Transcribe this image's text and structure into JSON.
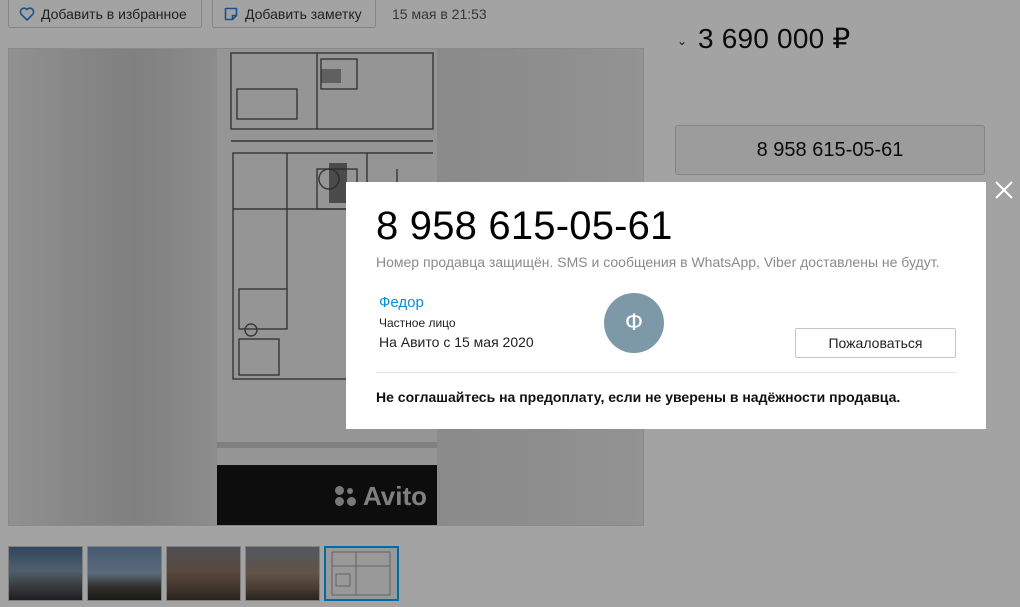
{
  "toolbar": {
    "favorite_label": "Добавить в избранное",
    "note_label": "Добавить заметку",
    "date": "15 мая в 21:53"
  },
  "listing": {
    "price": "3 690 000 ₽",
    "phone_button": "8 958 615-05-61"
  },
  "gallery": {
    "watermark": "Avito",
    "thumbnails": [
      "фото 1",
      "фото 2",
      "фото 3",
      "фото 4",
      "планировка"
    ]
  },
  "modal": {
    "phone": "8 958 615-05-61",
    "note": "Номер продавца защищён. SMS и сообщения в WhatsApp, Viber доставлены не будут.",
    "seller_name": "Федор",
    "seller_type": "Частное лицо",
    "seller_since": "На Авито с 15 мая 2020",
    "avatar_letter": "Ф",
    "report_label": "Пожаловаться",
    "warning": "Не соглашайтесь на предоплату, если не уверены в надёжности продавца."
  },
  "colors": {
    "link": "#0091d9",
    "avatar": "#7d98a7",
    "thumb_active": "#00aaff"
  },
  "icons": [
    "heart-icon",
    "note-icon",
    "chevron-down-icon",
    "close-icon"
  ]
}
